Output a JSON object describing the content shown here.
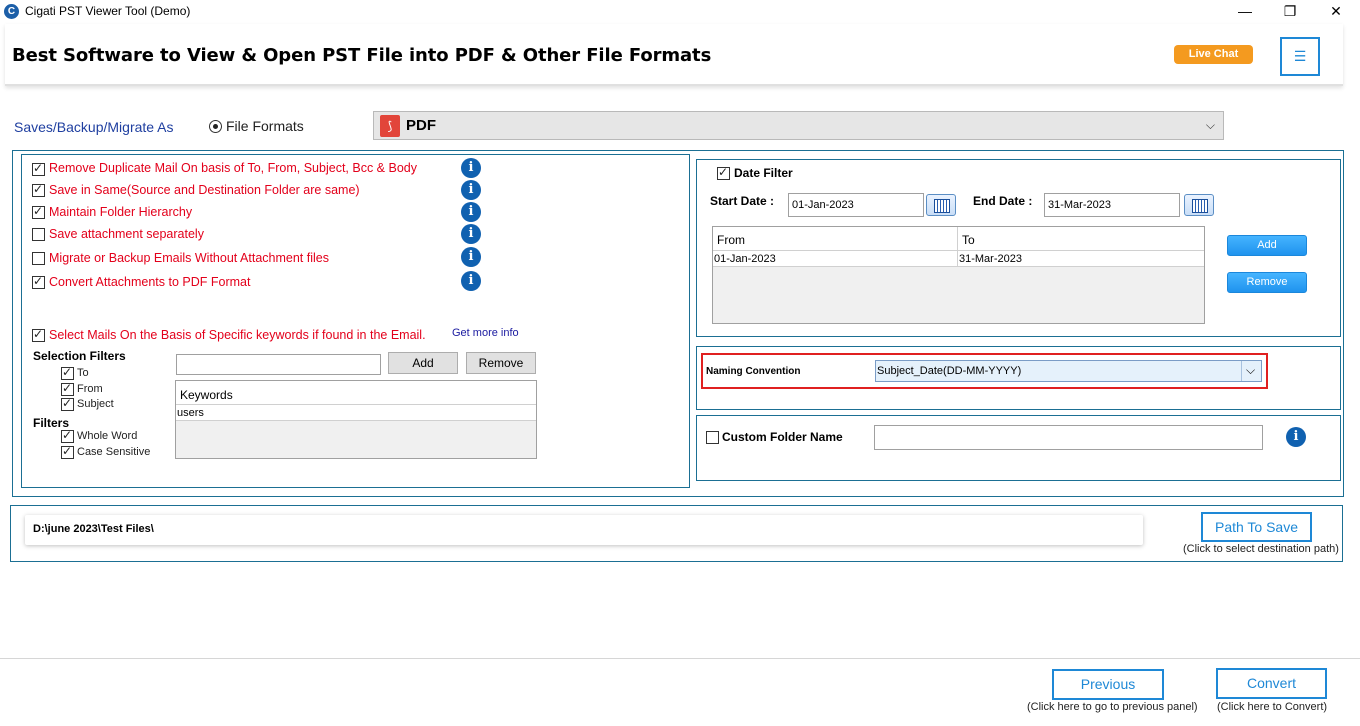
{
  "window": {
    "title": "Cigati PST Viewer Tool (Demo)",
    "minimize": "—",
    "maximize": "❐",
    "close": "✕",
    "app_icon": "C"
  },
  "header": {
    "title": "Best Software to View & Open PST File into PDF & Other File Formats",
    "live_chat": "Live Chat",
    "menu_icon": "☰"
  },
  "save_as": {
    "label": "Saves/Backup/Migrate As",
    "radio_label": "File Formats",
    "selected_format": "PDF",
    "dropdown_chevron": "⌵"
  },
  "options": [
    {
      "label": "Remove Duplicate Mail On basis of To, From, Subject, Bcc & Body",
      "checked": true
    },
    {
      "label": "Save in Same(Source and Destination Folder are same)",
      "checked": true
    },
    {
      "label": "Maintain Folder Hierarchy",
      "checked": true
    },
    {
      "label": "Save attachment separately",
      "checked": false
    },
    {
      "label": "Migrate or Backup Emails Without Attachment files",
      "checked": false
    },
    {
      "label": "Convert Attachments to PDF Format",
      "checked": true
    }
  ],
  "info_icon": "i",
  "keywords": {
    "select_label": "Select Mails On the Basis of Specific keywords if found in the Email.",
    "get_more_info": "Get more info",
    "selection_filters_title": "Selection Filters",
    "selection_filters": [
      {
        "label": "To",
        "checked": true
      },
      {
        "label": "From",
        "checked": true
      },
      {
        "label": "Subject",
        "checked": true
      }
    ],
    "filters_title": "Filters",
    "filters": [
      {
        "label": "Whole Word",
        "checked": true
      },
      {
        "label": "Case Sensitive",
        "checked": true
      }
    ],
    "input_value": "",
    "add_label": "Add",
    "remove_label": "Remove",
    "grid_header": "Keywords",
    "grid_rows": [
      "users"
    ]
  },
  "date_filter": {
    "label": "Date Filter",
    "checked": true,
    "start_label": "Start Date :",
    "start_value": "01-Jan-2023",
    "end_label": "End Date :",
    "end_value": "31-Mar-2023",
    "grid_headers": [
      "From",
      "To"
    ],
    "grid_rows": [
      [
        "01-Jan-2023",
        "31-Mar-2023"
      ]
    ],
    "add_label": "Add",
    "remove_label": "Remove"
  },
  "naming": {
    "label": "Naming Convention",
    "value": "Subject_Date(DD-MM-YYYY)",
    "highlight_color": "#e02020"
  },
  "custom_folder": {
    "label": "Custom Folder Name",
    "checked": false,
    "value": ""
  },
  "path": {
    "value": "D:\\june 2023\\Test Files\\",
    "button_label": "Path To Save",
    "hint": "(Click to select destination path)"
  },
  "footer": {
    "previous_label": "Previous",
    "previous_hint": "(Click here to go to previous panel)",
    "convert_label": "Convert",
    "convert_hint": "(Click here to Convert)"
  }
}
